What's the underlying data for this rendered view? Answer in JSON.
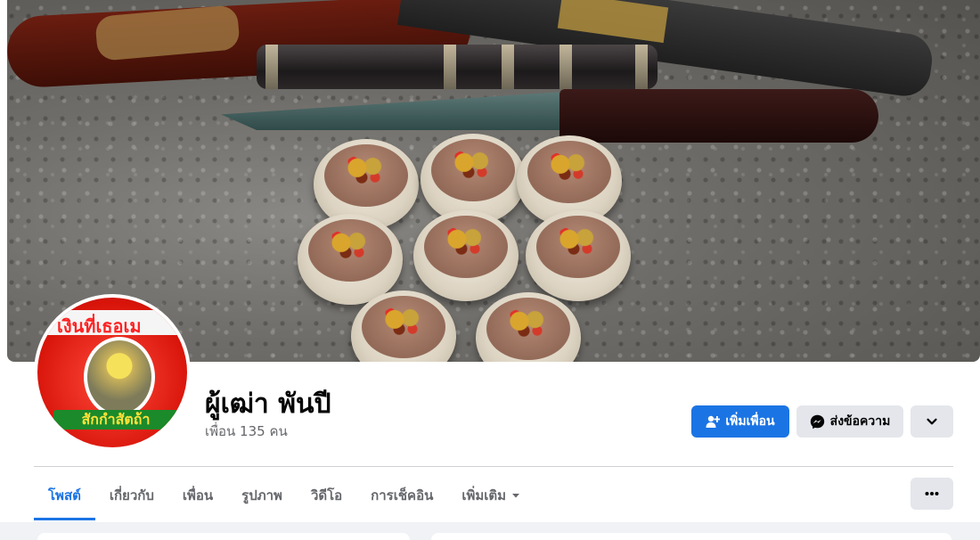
{
  "profile": {
    "name": "ผู้เฒ่า พันปี",
    "friends_count": "เพื่อน 135 คน",
    "avatar_banner_text": "เงินที่เธอเม",
    "avatar_footer_text": "สักกำสัตถ้า"
  },
  "actions": {
    "add_friend_label": "เพิ่มเพื่อน",
    "message_label": "ส่งข้อความ",
    "add_friend_icon": "add-friend-icon",
    "message_icon": "messenger-icon",
    "more_icon": "chevron-down-icon"
  },
  "tabs": [
    {
      "label": "โพสต์",
      "active": true
    },
    {
      "label": "เกี่ยวกับ",
      "active": false
    },
    {
      "label": "เพื่อน",
      "active": false
    },
    {
      "label": "รูปภาพ",
      "active": false
    },
    {
      "label": "วิดีโอ",
      "active": false
    },
    {
      "label": "การเช็คอิน",
      "active": false
    },
    {
      "label": "เพิ่มเติม",
      "active": false
    }
  ],
  "colors": {
    "accent": "#1b74e4",
    "secondary_button": "#e4e6eb",
    "page_background": "#f0f2f5"
  }
}
